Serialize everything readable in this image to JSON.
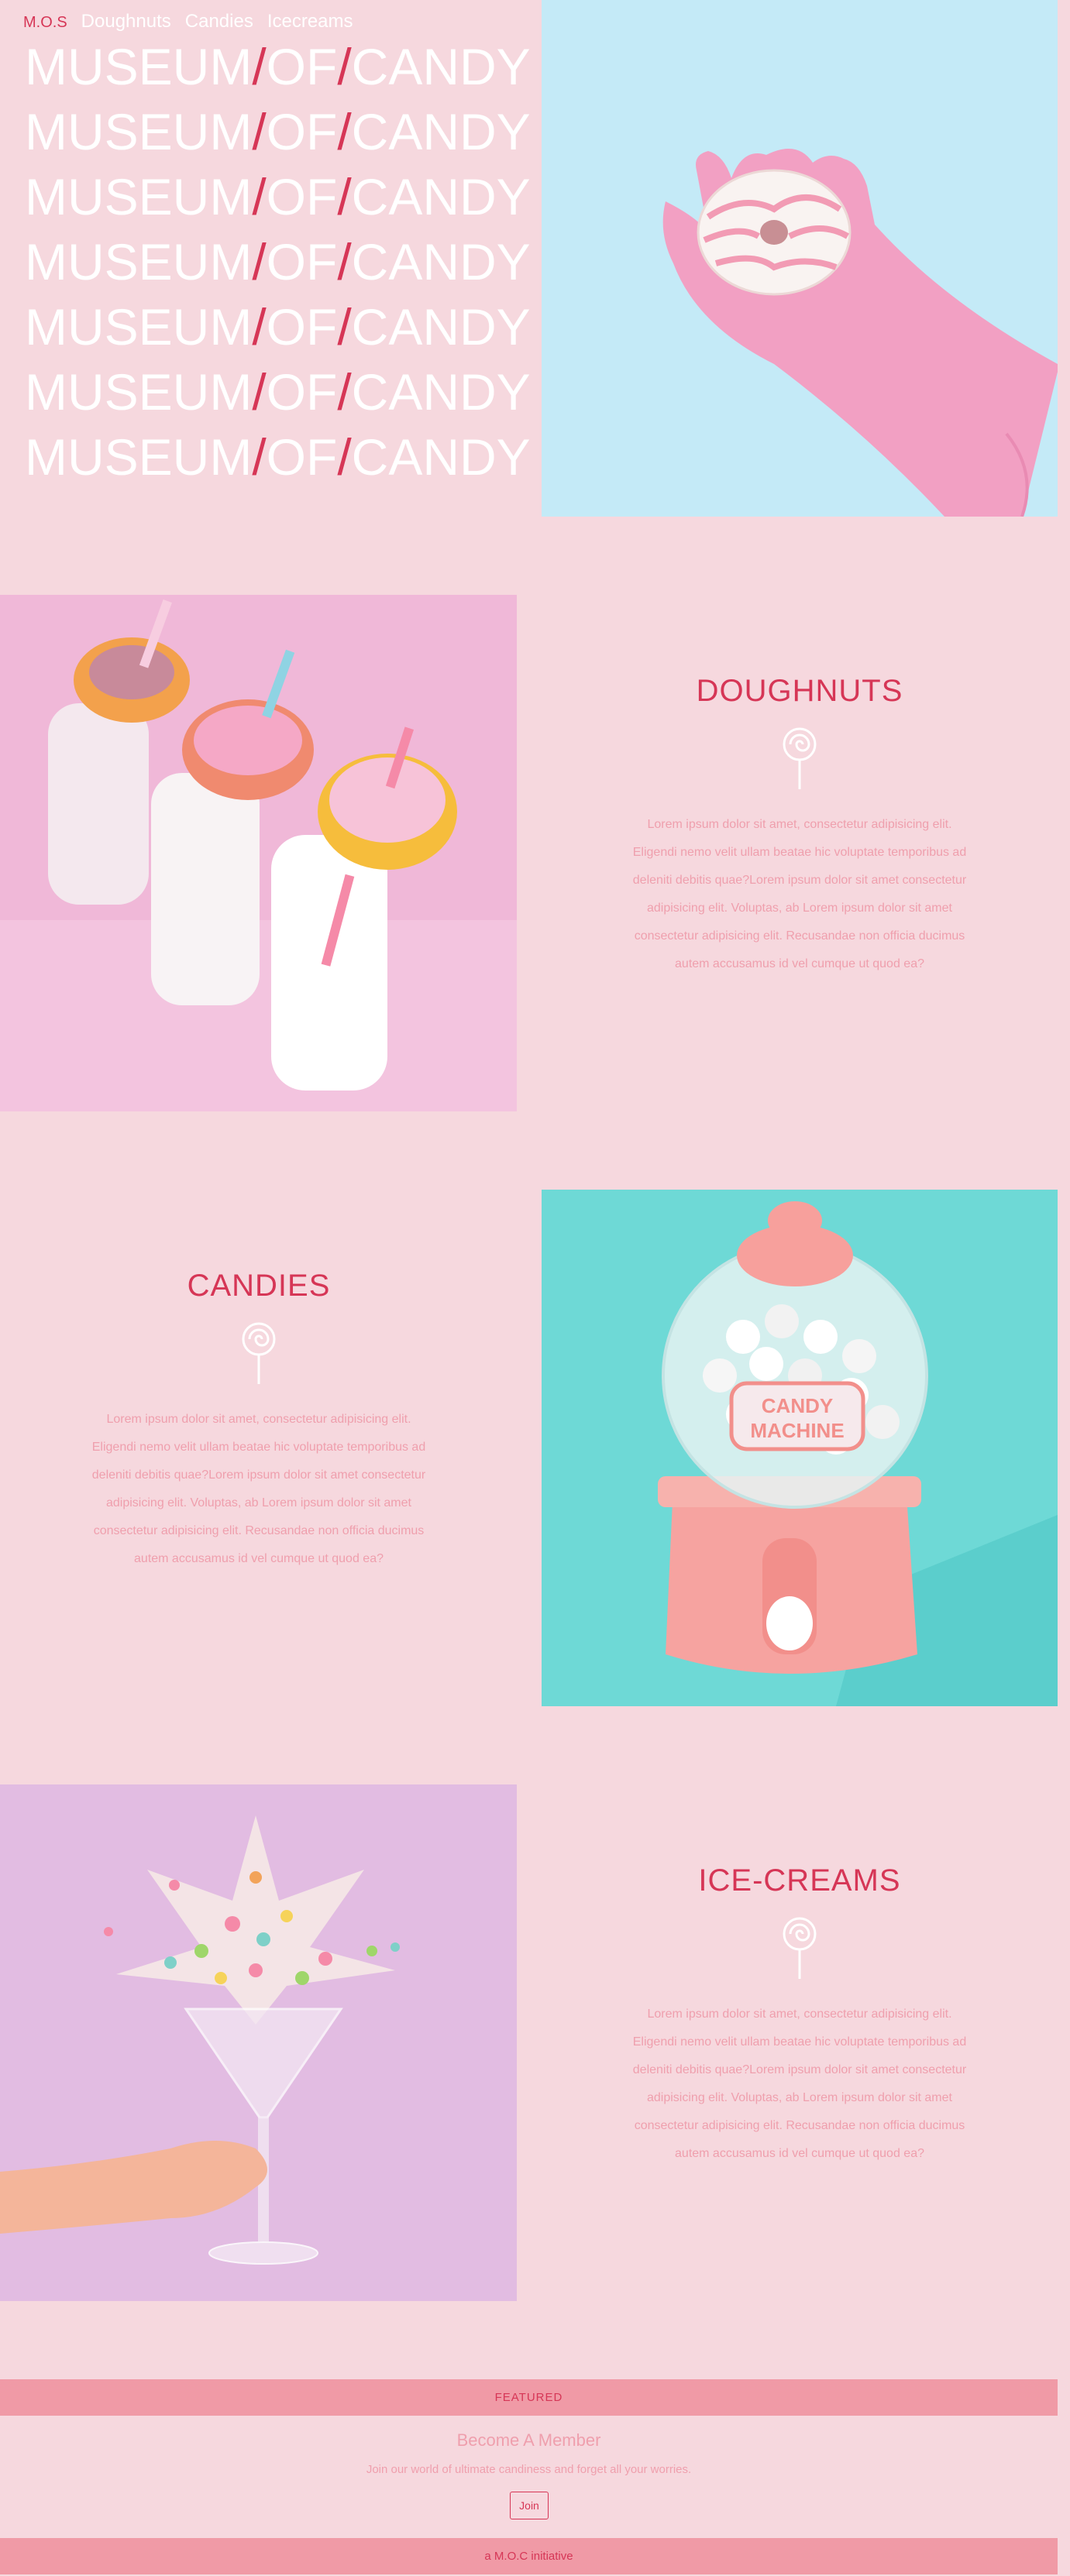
{
  "nav": {
    "logo": "M.O.S",
    "links": [
      "Doughnuts",
      "Candies",
      "Icecreams"
    ]
  },
  "hero": {
    "word1": "MUSEUM",
    "word2": "OF",
    "word3": "CANDY",
    "slash": "/"
  },
  "sections": [
    {
      "title": "DOUGHNUTS",
      "icon": "lollipop-icon",
      "body": "Lorem ipsum dolor sit amet, consectetur adipisicing elit. Eligendi nemo velit ullam beatae hic voluptate temporibus ad deleniti debitis quae?Lorem ipsum dolor sit amet consectetur adipisicing elit. Voluptas, ab Lorem ipsum dolor sit amet consectetur adipisicing elit. Recusandae non officia ducimus autem accusamus id vel cumque ut quod ea?"
    },
    {
      "title": "CANDIES",
      "icon": "lollipop-icon",
      "body": "Lorem ipsum dolor sit amet, consectetur adipisicing elit. Eligendi nemo velit ullam beatae hic voluptate temporibus ad deleniti debitis quae?Lorem ipsum dolor sit amet consectetur adipisicing elit. Voluptas, ab Lorem ipsum dolor sit amet consectetur adipisicing elit. Recusandae non officia ducimus autem accusamus id vel cumque ut quod ea?"
    },
    {
      "title": "ICE-CREAMS",
      "icon": "lollipop-icon",
      "body": "Lorem ipsum dolor sit amet, consectetur adipisicing elit. Eligendi nemo velit ullam beatae hic voluptate temporibus ad deleniti debitis quae?Lorem ipsum dolor sit amet consectetur adipisicing elit. Voluptas, ab Lorem ipsum dolor sit amet consectetur adipisicing elit. Recusandae non officia ducimus autem accusamus id vel cumque ut quod ea?"
    }
  ],
  "photos": {
    "glove_donut": "glove-holding-donut-photo",
    "milk_donuts": "milk-bottles-donuts-photo",
    "candy_machine": "candy-machine-photo",
    "sprinkles_glass": "sprinkles-glass-photo",
    "candy_machine_label_1": "CANDY",
    "candy_machine_label_2": "MACHINE"
  },
  "footer": {
    "featured": "FEATURED",
    "member_title": "Become A Member",
    "member_sub": "Join our world of ultimate candiness and forget all your worries.",
    "join": "Join",
    "initiative": "a M.O.C initiative"
  },
  "colors": {
    "background": "#f6d8de",
    "accent": "#d63656",
    "soft_text": "#ef9fad",
    "bar": "#f09aa6"
  }
}
